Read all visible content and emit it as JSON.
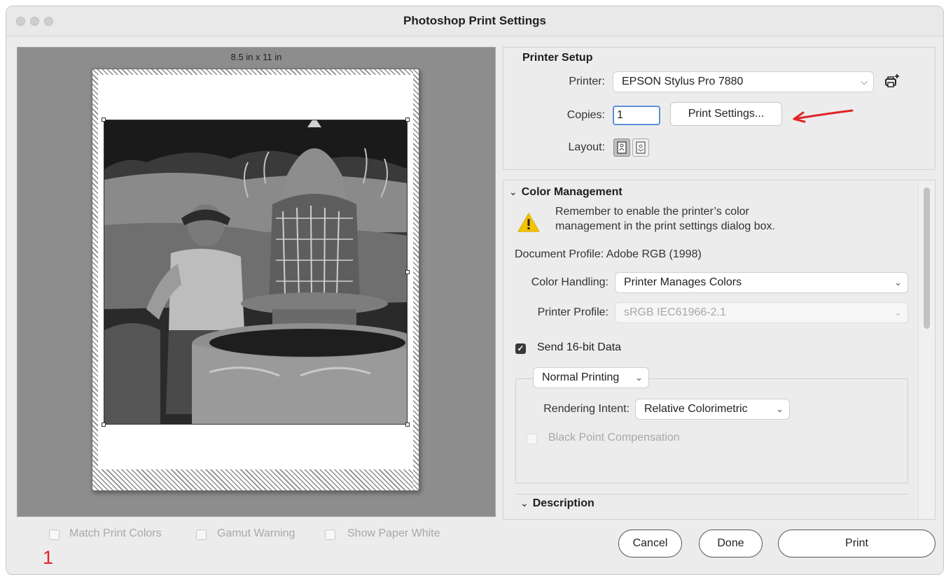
{
  "window": {
    "title": "Photoshop Print Settings"
  },
  "preview": {
    "paper_size": "8.5 in x 11 in"
  },
  "bottom_options": [
    {
      "label": "Match Print Colors",
      "checked": false
    },
    {
      "label": "Gamut Warning",
      "checked": false
    },
    {
      "label": "Show Paper White",
      "checked": false
    }
  ],
  "annotation": {
    "number": "1",
    "color": "#e0242a"
  },
  "printer_setup": {
    "heading": "Printer Setup",
    "printer_label": "Printer:",
    "printer_value": "EPSON Stylus Pro 7880",
    "copies_label": "Copies:",
    "copies_value": "1",
    "print_settings_button": "Print Settings...",
    "layout_label": "Layout:"
  },
  "color_management": {
    "heading": "Color Management",
    "warning_line1": "Remember to enable the printer’s color",
    "warning_line2": "management in the print settings dialog box.",
    "document_profile": "Document Profile: Adobe RGB (1998)",
    "color_handling_label": "Color Handling:",
    "color_handling_value": "Printer Manages Colors",
    "printer_profile_label": "Printer Profile:",
    "printer_profile_value": "sRGB IEC61966-2.1",
    "send16_label": "Send 16-bit Data",
    "send16_checked": true,
    "normal_printing": "Normal Printing",
    "rendering_intent_label": "Rendering Intent:",
    "rendering_intent_value": "Relative Colorimetric",
    "black_point_label": "Black Point Compensation",
    "black_point_checked": false
  },
  "description": {
    "heading": "Description"
  },
  "buttons": {
    "cancel": "Cancel",
    "done": "Done",
    "print": "Print"
  },
  "colors": {
    "warning": "#f5c400",
    "focus": "#5b8fdc",
    "annotation_arrow": "#e0242a"
  }
}
